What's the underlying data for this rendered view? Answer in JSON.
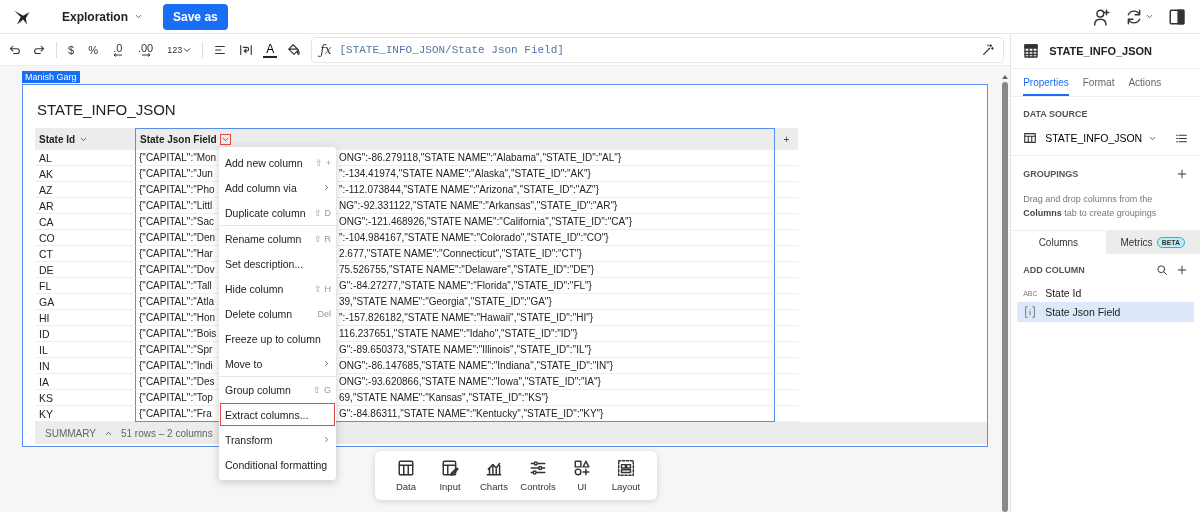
{
  "app_bar": {
    "document_title": "Exploration",
    "save_button": "Save as"
  },
  "toolbar": {
    "format_buttons": [
      {
        "kind": "plain",
        "label": "$"
      },
      {
        "kind": "plain",
        "label": "%"
      },
      {
        "kind": "decrease",
        "label": ".0"
      },
      {
        "kind": "increase",
        "label": ".00"
      },
      {
        "kind": "dropdown",
        "label": "123"
      }
    ],
    "text_color_label": "A",
    "formula_label": "ƒx",
    "formula": "[STATE_INFO_JSON/State Json Field]"
  },
  "canvas": {
    "owner_tag": "Manish Garg",
    "title": "STATE_INFO_JSON",
    "columns": [
      {
        "name": "State Id",
        "menu_open": false
      },
      {
        "name": "State Json Field",
        "menu_open": true
      }
    ],
    "add_column_label": "+",
    "rows": [
      {
        "id": "AL",
        "json_start": "{\"CAPITAL\":\"Mon",
        "json_end": "ONG\":-86.279118,\"STATE NAME\":\"Alabama\",\"STATE_ID\":\"AL\"}"
      },
      {
        "id": "AK",
        "json_start": "{\"CAPITAL\":\"Jun",
        "json_end": "\":-134.41974,\"STATE NAME\":\"Alaska\",\"STATE_ID\":\"AK\"}"
      },
      {
        "id": "AZ",
        "json_start": "{\"CAPITAL\":\"Pho",
        "json_end": "\":-112.073844,\"STATE NAME\":\"Arizona\",\"STATE_ID\":\"AZ\"}"
      },
      {
        "id": "AR",
        "json_start": "{\"CAPITAL\":\"Littl",
        "json_end": "NG\":-92.331122,\"STATE NAME\":\"Arkansas\",\"STATE_ID\":\"AR\"}"
      },
      {
        "id": "CA",
        "json_start": "{\"CAPITAL\":\"Sac",
        "json_end": "ONG\":-121.468926,\"STATE NAME\":\"California\",\"STATE_ID\":\"CA\"}"
      },
      {
        "id": "CO",
        "json_start": "{\"CAPITAL\":\"Den",
        "json_end": "\":-104.984167,\"STATE NAME\":\"Colorado\",\"STATE_ID\":\"CO\"}"
      },
      {
        "id": "CT",
        "json_start": "{\"CAPITAL\":\"Har",
        "json_end": "2.677,\"STATE NAME\":\"Connecticut\",\"STATE_ID\":\"CT\"}"
      },
      {
        "id": "DE",
        "json_start": "{\"CAPITAL\":\"Dov",
        "json_end": "75.526755,\"STATE NAME\":\"Delaware\",\"STATE_ID\":\"DE\"}"
      },
      {
        "id": "FL",
        "json_start": "{\"CAPITAL\":\"Tall",
        "json_end": "G\":-84.27277,\"STATE NAME\":\"Florida\",\"STATE_ID\":\"FL\"}"
      },
      {
        "id": "GA",
        "json_start": "{\"CAPITAL\":\"Atla",
        "json_end": "39,\"STATE NAME\":\"Georgia\",\"STATE_ID\":\"GA\"}"
      },
      {
        "id": "HI",
        "json_start": "{\"CAPITAL\":\"Hon",
        "json_end": "\":-157.826182,\"STATE NAME\":\"Hawaii\",\"STATE_ID\":\"HI\"}"
      },
      {
        "id": "ID",
        "json_start": "{\"CAPITAL\":\"Bois",
        "json_end": "116.237651,\"STATE NAME\":\"Idaho\",\"STATE_ID\":\"ID\"}"
      },
      {
        "id": "IL",
        "json_start": "{\"CAPITAL\":\"Spr",
        "json_end": "G\":-89.650373,\"STATE NAME\":\"Illinois\",\"STATE_ID\":\"IL\"}"
      },
      {
        "id": "IN",
        "json_start": "{\"CAPITAL\":\"Indi",
        "json_end": "ONG\":-86.147685,\"STATE NAME\":\"Indiana\",\"STATE_ID\":\"IN\"}"
      },
      {
        "id": "IA",
        "json_start": "{\"CAPITAL\":\"Des",
        "json_end": "ONG\":-93.620866,\"STATE NAME\":\"Iowa\",\"STATE_ID\":\"IA\"}"
      },
      {
        "id": "KS",
        "json_start": "{\"CAPITAL\":\"Top",
        "json_end": "69,\"STATE NAME\":\"Kansas\",\"STATE_ID\":\"KS\"}"
      },
      {
        "id": "KY",
        "json_start": "{\"CAPITAL\":\"Fra",
        "json_end": "G\":-84.86311,\"STATE NAME\":\"Kentucky\",\"STATE_ID\":\"KY\"}"
      }
    ],
    "summary": {
      "label": "SUMMARY",
      "text": "51 rows – 2 columns"
    },
    "column_menu": [
      {
        "label": "Add new column",
        "shortcut": "⇧ +",
        "submenu": false,
        "highlighted": false,
        "divider_after": false
      },
      {
        "label": "Add column via",
        "submenu": true,
        "highlighted": false,
        "divider_after": false
      },
      {
        "label": "Duplicate column",
        "shortcut": "⇧ D",
        "submenu": false,
        "highlighted": false,
        "divider_after": true
      },
      {
        "label": "Rename column",
        "shortcut": "⇧ R",
        "submenu": false,
        "highlighted": false,
        "divider_after": false
      },
      {
        "label": "Set description...",
        "submenu": false,
        "highlighted": false,
        "divider_after": false
      },
      {
        "label": "Hide column",
        "shortcut": "⇧ H",
        "submenu": false,
        "highlighted": false,
        "divider_after": false
      },
      {
        "label": "Delete column",
        "shortcut": "Del",
        "submenu": false,
        "highlighted": false,
        "divider_after": false
      },
      {
        "label": "Freeze up to column",
        "submenu": false,
        "highlighted": false,
        "divider_after": false
      },
      {
        "label": "Move to",
        "submenu": true,
        "highlighted": false,
        "divider_after": true
      },
      {
        "label": "Group column",
        "shortcut": "⇧ G",
        "submenu": false,
        "highlighted": false,
        "divider_after": false
      },
      {
        "label": "Extract columns...",
        "submenu": false,
        "highlighted": true,
        "divider_after": false
      },
      {
        "label": "Transform",
        "submenu": true,
        "highlighted": false,
        "divider_after": false
      },
      {
        "label": "Conditional formatting",
        "submenu": false,
        "highlighted": false,
        "divider_after": false
      }
    ],
    "add_panel": [
      {
        "kind": "data",
        "label": "Data"
      },
      {
        "kind": "input",
        "label": "Input"
      },
      {
        "kind": "charts",
        "label": "Charts"
      },
      {
        "kind": "controls",
        "label": "Controls"
      },
      {
        "kind": "ui",
        "label": "UI"
      },
      {
        "kind": "layout",
        "label": "Layout"
      }
    ]
  },
  "properties_panel": {
    "title": "STATE_INFO_JSON",
    "tabs": [
      {
        "label": "Properties",
        "selected": true
      },
      {
        "label": "Format",
        "selected": false
      },
      {
        "label": "Actions",
        "selected": false
      }
    ],
    "data_source_heading": "DATA SOURCE",
    "data_source": "STATE_INFO_JSON",
    "groupings_heading": "GROUPINGS",
    "groupings_hint": "Drag and drop columns from the **Columns** tab to create groupings",
    "column_tabs": [
      {
        "label": "Columns",
        "selected": true
      },
      {
        "label": "Metrics",
        "badge": "BETA",
        "selected": false
      }
    ],
    "add_column_heading": "ADD COLUMN",
    "columns": [
      {
        "kind": "text",
        "type_label": "ABC",
        "name": "State Id",
        "selected": false
      },
      {
        "kind": "json",
        "name": "State Json Field",
        "selected": true
      }
    ]
  }
}
